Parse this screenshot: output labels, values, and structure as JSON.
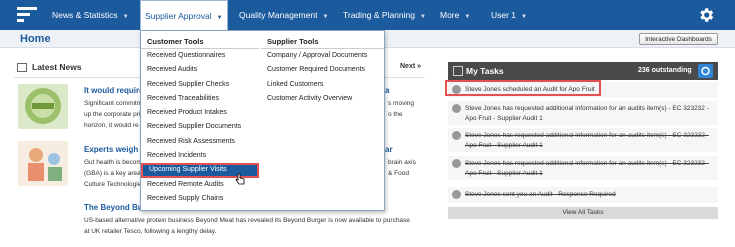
{
  "nav": {
    "items": [
      "News & Statistics",
      "Supplier Approval",
      "Quality Management",
      "Trading & Planning",
      "More",
      "User 1"
    ]
  },
  "header": {
    "title": "Home",
    "dashboards_button": "Interactive Dashboards"
  },
  "news": {
    "title": "Latest News",
    "next": "Next »",
    "items": [
      {
        "title": "It would require",
        "title_tail": "a",
        "lines": [
          "Significant commitm",
          "up the corporate pri",
          "horizon, it would re"
        ],
        "lines_tail": [
          "s moving",
          "o the",
          ""
        ]
      },
      {
        "title": "Experts weigh i",
        "title_tail": "ar",
        "lines": [
          "Gut health is becom",
          "(GBA) is a key area",
          "Culture Technologie"
        ],
        "lines_tail": [
          "brain axis",
          "& Food",
          ""
        ]
      },
      {
        "title": "The Beyond Bu",
        "lines": [
          "US-based alternative protein business Beyond Meat has revealed its Beyond Burger is now available to purchase",
          "at UK retailer Tesco, following a lengthy delay."
        ]
      }
    ]
  },
  "dropdown": {
    "col1_title": "Customer Tools",
    "col1_items": [
      "Received Questionnaires",
      "Received Audits",
      "Received Supplier Checks",
      "Received Traceabilities",
      "Received Product Intakes",
      "Received Supplier Documents",
      "Received Risk Assessments",
      "Received Incidents",
      "Upcoming Supplier Visits",
      "Received Remote Audits",
      "Received Supply Chains"
    ],
    "col2_title": "Supplier Tools",
    "col2_items": [
      "Company / Approval Documents",
      "Customer Required Documents",
      "Linked Customers",
      "Customer Activity Overview"
    ]
  },
  "tasks": {
    "title": "My Tasks",
    "count": "236 outstanding",
    "items": [
      {
        "lines": [
          "Steve Jones scheduled an Audit for Apo Fruit"
        ],
        "done": false
      },
      {
        "lines": [
          "Steve Jones has requested additional information for an audits item(s) - EC 323232 -",
          "Apo Fruit - Supplier Audit 1"
        ],
        "done": false
      },
      {
        "lines": [
          "Steve Jones has requested additional information for an audits item(s) - EC 323232 -",
          "Apo Fruit - Supplier Audit 1"
        ],
        "done": true
      },
      {
        "lines": [
          "Steve Jones has requested additional information for an audits item(s) - EC 323232 -",
          "Apo Fruit - Supplier Audit 1"
        ],
        "done": true
      },
      {
        "lines": [
          "Steve Jones sent you an Audit - Response Required"
        ],
        "done": true
      }
    ],
    "view_all": "View All Tasks"
  },
  "colors": {
    "brand": "#1c5a9e",
    "highlight": "#e05252"
  }
}
